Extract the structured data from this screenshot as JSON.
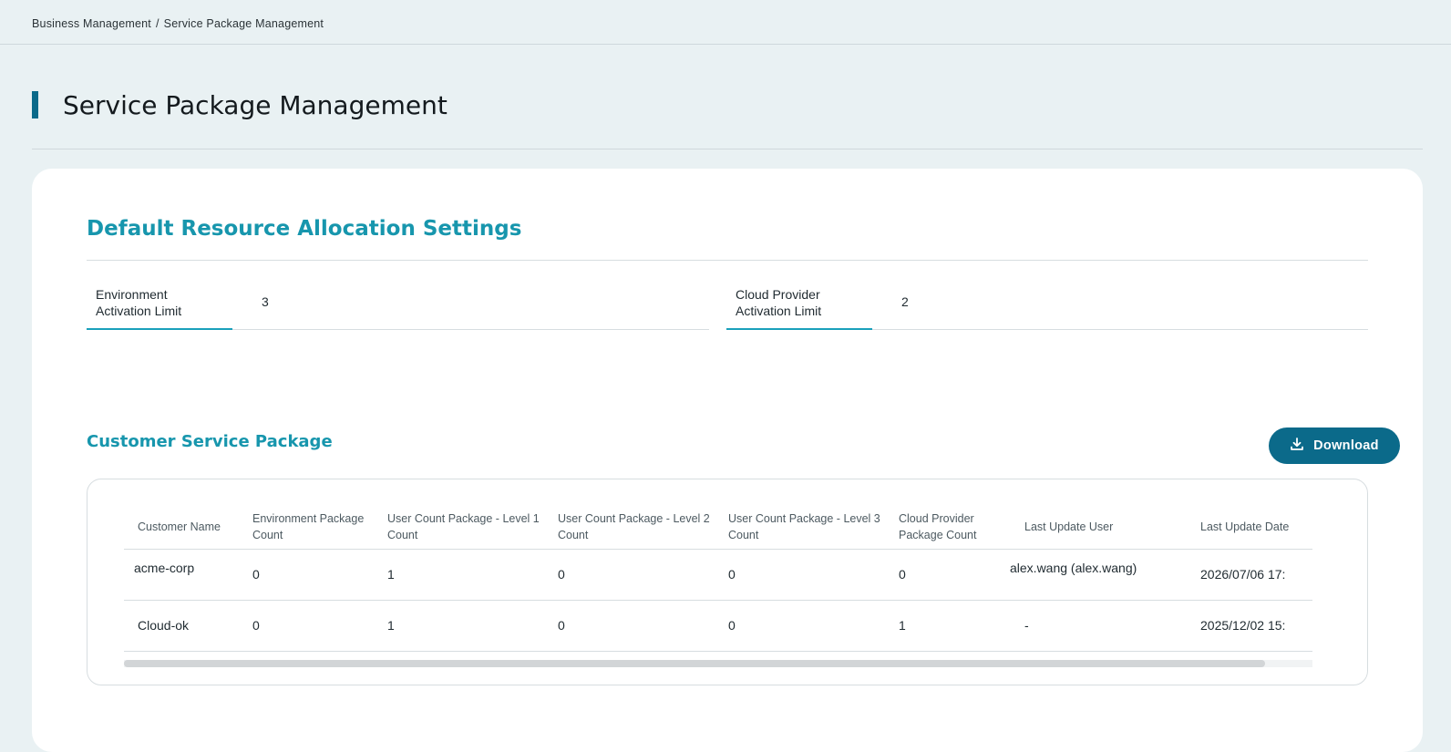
{
  "breadcrumb": {
    "items": [
      "Business Management",
      "Service Package Management"
    ],
    "separator": "/"
  },
  "page": {
    "title": "Service Package Management",
    "accent_color": "#0b6a8a"
  },
  "defaults": {
    "title": "Default Resource Allocation Settings",
    "fields": [
      {
        "label_line1": "Environment",
        "label_line2": "Activation Limit",
        "value": "3"
      },
      {
        "label_line1": "Cloud Provider",
        "label_line2": "Activation Limit",
        "value": "2"
      }
    ]
  },
  "customer_packages": {
    "title": "Customer Service Package",
    "download_label": "Download",
    "columns": [
      "Customer Name",
      "Environment Package Count",
      "User Count Package - Level 1 Count",
      "User Count Package - Level 2 Count",
      "User Count Package - Level 3 Count",
      "Cloud Provider Package Count",
      "Last Update User",
      "Last Update Date"
    ],
    "rows": [
      [
        "acme-corp",
        "0",
        "1",
        "0",
        "0",
        "0",
        "alex.wang (alex.wang)",
        "2026/07/06 17:"
      ],
      [
        "Cloud-ok",
        "0",
        "1",
        "0",
        "0",
        "1",
        "-",
        "2025/12/02 15:"
      ]
    ],
    "scroll_fraction": 0.96
  },
  "colors": {
    "background": "#e9f1f3",
    "section_title": "#1796ad",
    "button": "#0b6a8a"
  },
  "icons": {
    "download": "download-icon"
  }
}
